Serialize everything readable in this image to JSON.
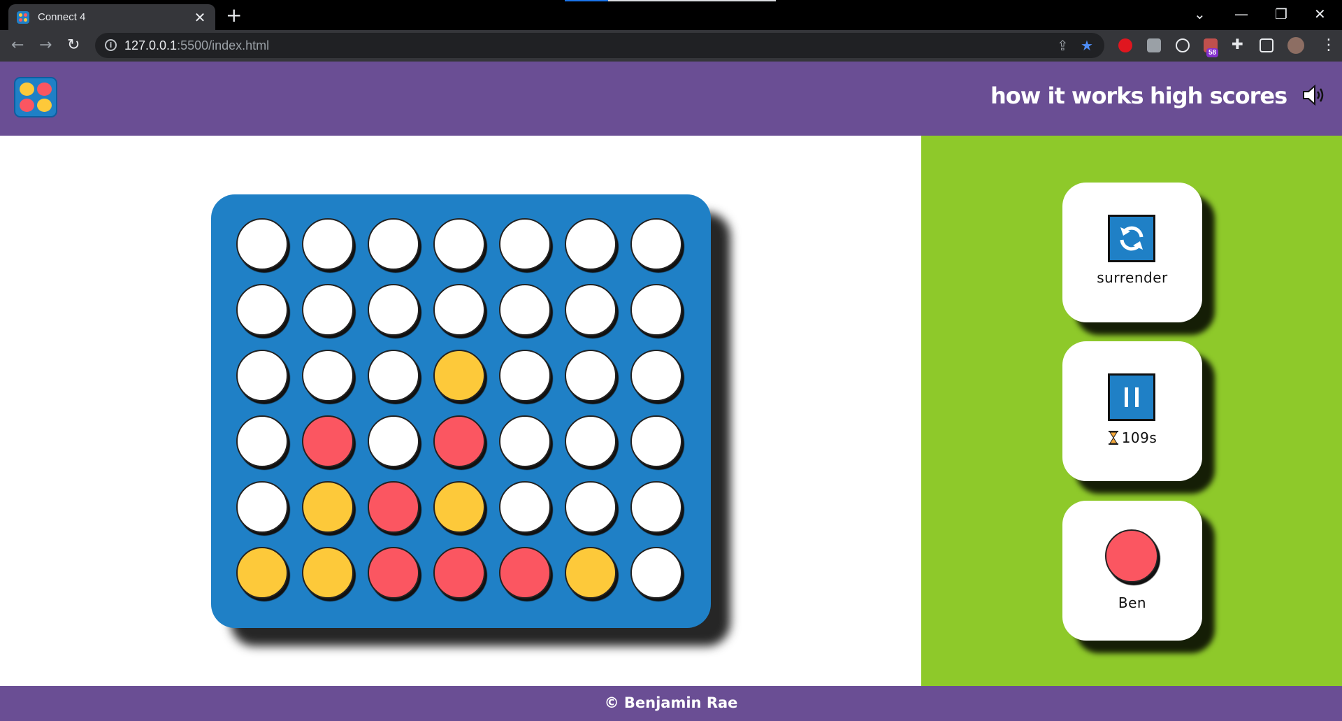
{
  "browser": {
    "tab_title": "Connect 4",
    "tab_close": "✕",
    "new_tab": "+",
    "url_host": "127.0.0.1",
    "url_rest": ":5500/index.html",
    "extension_badge": "58"
  },
  "header": {
    "nav": [
      {
        "label": "how it works"
      },
      {
        "label": "high scores"
      }
    ],
    "icons": [
      "connect4-logo-icon",
      "speaker-icon"
    ]
  },
  "colors": {
    "header_bg": "#6a4e94",
    "board": "#1f80c6",
    "side_panel": "#8ec92a",
    "red": "#fb5661",
    "yellow": "#fdc93a",
    "empty": "#ffffff"
  },
  "board": {
    "columns": 7,
    "rows": [
      [
        "empty",
        "empty",
        "empty",
        "empty",
        "empty",
        "empty",
        "empty"
      ],
      [
        "empty",
        "empty",
        "empty",
        "empty",
        "empty",
        "empty",
        "empty"
      ],
      [
        "empty",
        "empty",
        "empty",
        "yellow",
        "empty",
        "empty",
        "empty"
      ],
      [
        "empty",
        "red",
        "empty",
        "red",
        "empty",
        "empty",
        "empty"
      ],
      [
        "empty",
        "yellow",
        "red",
        "yellow",
        "empty",
        "empty",
        "empty"
      ],
      [
        "yellow",
        "yellow",
        "red",
        "red",
        "red",
        "yellow",
        "empty"
      ]
    ]
  },
  "sidebar": {
    "surrender": {
      "label": "surrender",
      "icon": "refresh-icon"
    },
    "timer": {
      "value": "109s",
      "icon": "pause-icon",
      "timer_icon": "hourglass-icon"
    },
    "current_player": {
      "name": "Ben",
      "color": "red"
    }
  },
  "footer": {
    "text": "© Benjamin Rae"
  }
}
